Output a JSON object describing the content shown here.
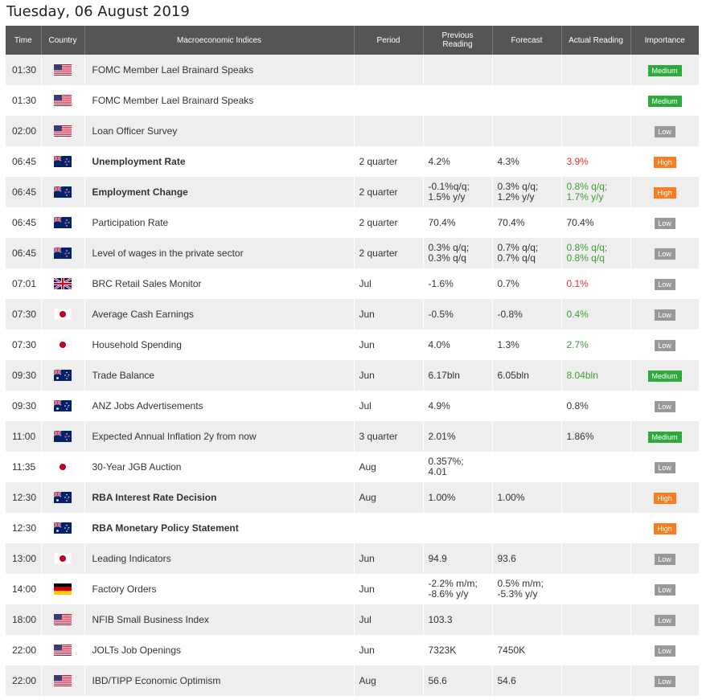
{
  "page_title": "Tuesday, 06 August 2019",
  "columns": [
    "Time",
    "Country",
    "Macroeconomic Indices",
    "Period",
    "Previous Reading",
    "Forecast",
    "Actual Reading",
    "Importance"
  ],
  "colors": {
    "header_bg": "#555555",
    "positive": "#3f9c35",
    "negative": "#e03131",
    "low": "#999999",
    "medium": "#2eaa3c",
    "high": "#ff7a1a"
  },
  "rows": [
    {
      "time": "01:30",
      "country": "us",
      "name": "FOMC Member Lael Brainard Speaks",
      "bold": false,
      "period": "",
      "prev": "",
      "forecast": "",
      "actual": "",
      "actual_color": "",
      "importance": "Medium"
    },
    {
      "time": "01:30",
      "country": "us",
      "name": "FOMC Member Lael Brainard Speaks",
      "bold": false,
      "period": "",
      "prev": "",
      "forecast": "",
      "actual": "",
      "actual_color": "",
      "importance": "Medium"
    },
    {
      "time": "02:00",
      "country": "us",
      "name": "Loan Officer Survey",
      "bold": false,
      "period": "",
      "prev": "",
      "forecast": "",
      "actual": "",
      "actual_color": "",
      "importance": "Low"
    },
    {
      "time": "06:45",
      "country": "nz",
      "name": "Unemployment Rate",
      "bold": true,
      "period": "2 quarter",
      "prev": "4.2%",
      "forecast": "4.3%",
      "actual": "3.9%",
      "actual_color": "red",
      "importance": "High"
    },
    {
      "time": "06:45",
      "country": "nz",
      "name": "Employment Change",
      "bold": true,
      "period": "2 quarter",
      "prev": "-0.1%q/q;\n1.5% y/y",
      "forecast": "0.3% q/q;\n1.2% y/y",
      "actual": "0.8% q/q;\n1.7% y/y",
      "actual_color": "green",
      "importance": "High"
    },
    {
      "time": "06:45",
      "country": "nz",
      "name": "Participation Rate",
      "bold": false,
      "period": "2 quarter",
      "prev": "70.4%",
      "forecast": "70.4%",
      "actual": "70.4%",
      "actual_color": "",
      "importance": "Low"
    },
    {
      "time": "06:45",
      "country": "nz",
      "name": "Level of wages in the private sector",
      "bold": false,
      "period": "2 quarter",
      "prev": "0.3% q/q;\n0.3% q/q",
      "forecast": "0.7% q/q;\n0.7% q/q",
      "actual": "0.8% q/q;\n0.8% q/q",
      "actual_color": "green",
      "importance": "Low"
    },
    {
      "time": "07:01",
      "country": "uk",
      "name": "BRC Retail Sales Monitor",
      "bold": false,
      "period": "Jul",
      "prev": "-1.6%",
      "forecast": "0.7%",
      "actual": "0.1%",
      "actual_color": "red",
      "importance": "Low"
    },
    {
      "time": "07:30",
      "country": "jp",
      "name": "Average Cash Earnings",
      "bold": false,
      "period": "Jun",
      "prev": "-0.5%",
      "forecast": "-0.8%",
      "actual": "0.4%",
      "actual_color": "green",
      "importance": "Low"
    },
    {
      "time": "07:30",
      "country": "jp",
      "name": "Household Spending",
      "bold": false,
      "period": "Jun",
      "prev": "4.0%",
      "forecast": "1.3%",
      "actual": "2.7%",
      "actual_color": "green",
      "importance": "Low"
    },
    {
      "time": "09:30",
      "country": "au",
      "name": "Trade Balance",
      "bold": false,
      "period": "Jun",
      "prev": "6.17bln",
      "forecast": "6.05bln",
      "actual": "8.04bln",
      "actual_color": "green",
      "importance": "Medium"
    },
    {
      "time": "09:30",
      "country": "au",
      "name": "ANZ Jobs Advertisements",
      "bold": false,
      "period": "Jul",
      "prev": "4.9%",
      "forecast": "",
      "actual": "0.8%",
      "actual_color": "",
      "importance": "Low"
    },
    {
      "time": "11:00",
      "country": "nz",
      "name": "Expected Annual Inflation 2y from now",
      "bold": false,
      "period": "3 quarter",
      "prev": "2.01%",
      "forecast": "",
      "actual": "1.86%",
      "actual_color": "",
      "importance": "Medium"
    },
    {
      "time": "11:35",
      "country": "jp",
      "name": "30-Year JGB Auction",
      "bold": false,
      "period": "Aug",
      "prev": "0.357%;\n4.01",
      "forecast": "",
      "actual": "",
      "actual_color": "",
      "importance": "Low"
    },
    {
      "time": "12:30",
      "country": "au",
      "name": "RBA Interest Rate Decision",
      "bold": true,
      "period": "Aug",
      "prev": "1.00%",
      "forecast": "1.00%",
      "actual": "",
      "actual_color": "",
      "importance": "High"
    },
    {
      "time": "12:30",
      "country": "au",
      "name": "RBA Monetary Policy Statement",
      "bold": true,
      "period": "",
      "prev": "",
      "forecast": "",
      "actual": "",
      "actual_color": "",
      "importance": "High"
    },
    {
      "time": "13:00",
      "country": "jp",
      "name": "Leading Indicators",
      "bold": false,
      "period": "Jun",
      "prev": "94.9",
      "forecast": "93.6",
      "actual": "",
      "actual_color": "",
      "importance": "Low"
    },
    {
      "time": "14:00",
      "country": "de",
      "name": "Factory Orders",
      "bold": false,
      "period": "Jun",
      "prev": "-2.2% m/m;\n-8.6% y/y",
      "forecast": "0.5% m/m;\n-5.3% y/y",
      "actual": "",
      "actual_color": "",
      "importance": "Low"
    },
    {
      "time": "18:00",
      "country": "us",
      "name": "NFIB Small Business Index",
      "bold": false,
      "period": "Jul",
      "prev": "103.3",
      "forecast": "",
      "actual": "",
      "actual_color": "",
      "importance": "Low"
    },
    {
      "time": "22:00",
      "country": "us",
      "name": "JOLTs Job Openings",
      "bold": false,
      "period": "Jun",
      "prev": "7323K",
      "forecast": "7450K",
      "actual": "",
      "actual_color": "",
      "importance": "Low"
    },
    {
      "time": "22:00",
      "country": "us",
      "name": "IBD/TIPP Economic Optimism",
      "bold": false,
      "period": "Aug",
      "prev": "56.6",
      "forecast": "54.6",
      "actual": "",
      "actual_color": "",
      "importance": "Low"
    }
  ]
}
